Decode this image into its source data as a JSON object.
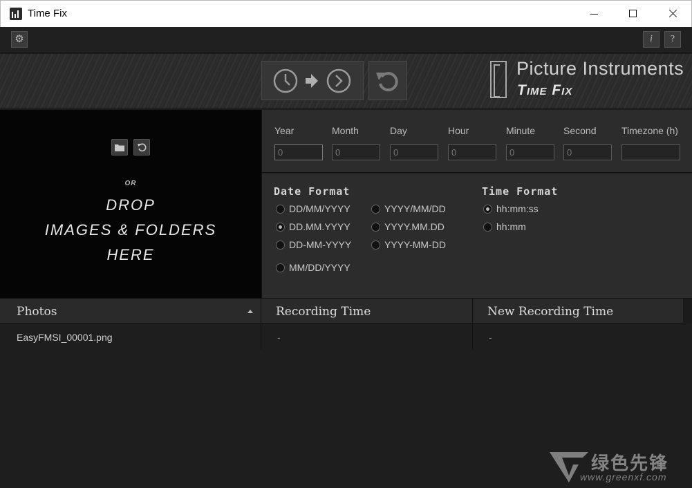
{
  "window": {
    "title": "Time Fix"
  },
  "toolbar": {
    "settings_icon": "gear-icon",
    "info_label": "i",
    "help_label": "?"
  },
  "header": {
    "convert_icon": "clock-arrow-clock-icon",
    "reset_icon": "reset-icon",
    "brand": "Picture Instruments",
    "product": "Time Fix"
  },
  "dropzone": {
    "folder_icon": "folder-icon",
    "refresh_icon": "refresh-icon",
    "or_text": "OR",
    "line1": "DROP",
    "line2": "IMAGES & FOLDERS",
    "line3": "HERE"
  },
  "offset": {
    "fields": [
      {
        "label": "Year",
        "value": "0"
      },
      {
        "label": "Month",
        "value": "0"
      },
      {
        "label": "Day",
        "value": "0"
      },
      {
        "label": "Hour",
        "value": "0"
      },
      {
        "label": "Minute",
        "value": "0"
      },
      {
        "label": "Second",
        "value": "0"
      },
      {
        "label": "Timezone (h)",
        "value": ""
      }
    ]
  },
  "date_format": {
    "title": "Date Format",
    "options": [
      {
        "label": "DD/MM/YYYY",
        "selected": false
      },
      {
        "label": "YYYY/MM/DD",
        "selected": false
      },
      {
        "label": "DD.MM.YYYY",
        "selected": true
      },
      {
        "label": "YYYY.MM.DD",
        "selected": false
      },
      {
        "label": "DD-MM-YYYY",
        "selected": false
      },
      {
        "label": "YYYY-MM-DD",
        "selected": false
      },
      {
        "label": "MM/DD/YYYY",
        "selected": false
      }
    ]
  },
  "time_format": {
    "title": "Time Format",
    "options": [
      {
        "label": "hh:mm:ss",
        "selected": true
      },
      {
        "label": "hh:mm",
        "selected": false
      }
    ]
  },
  "table": {
    "columns": [
      "Photos",
      "Recording Time",
      "New Recording Time"
    ],
    "rows": [
      {
        "photo": "EasyFMSI_00001.png",
        "recording": "-",
        "new_recording": "-"
      }
    ]
  },
  "watermark": {
    "text": "绿色先锋",
    "url": "www.greenxf.com"
  },
  "colors": {
    "background": "#1d1d1d",
    "panel": "#2c2c2c",
    "dropzone": "#050505"
  }
}
